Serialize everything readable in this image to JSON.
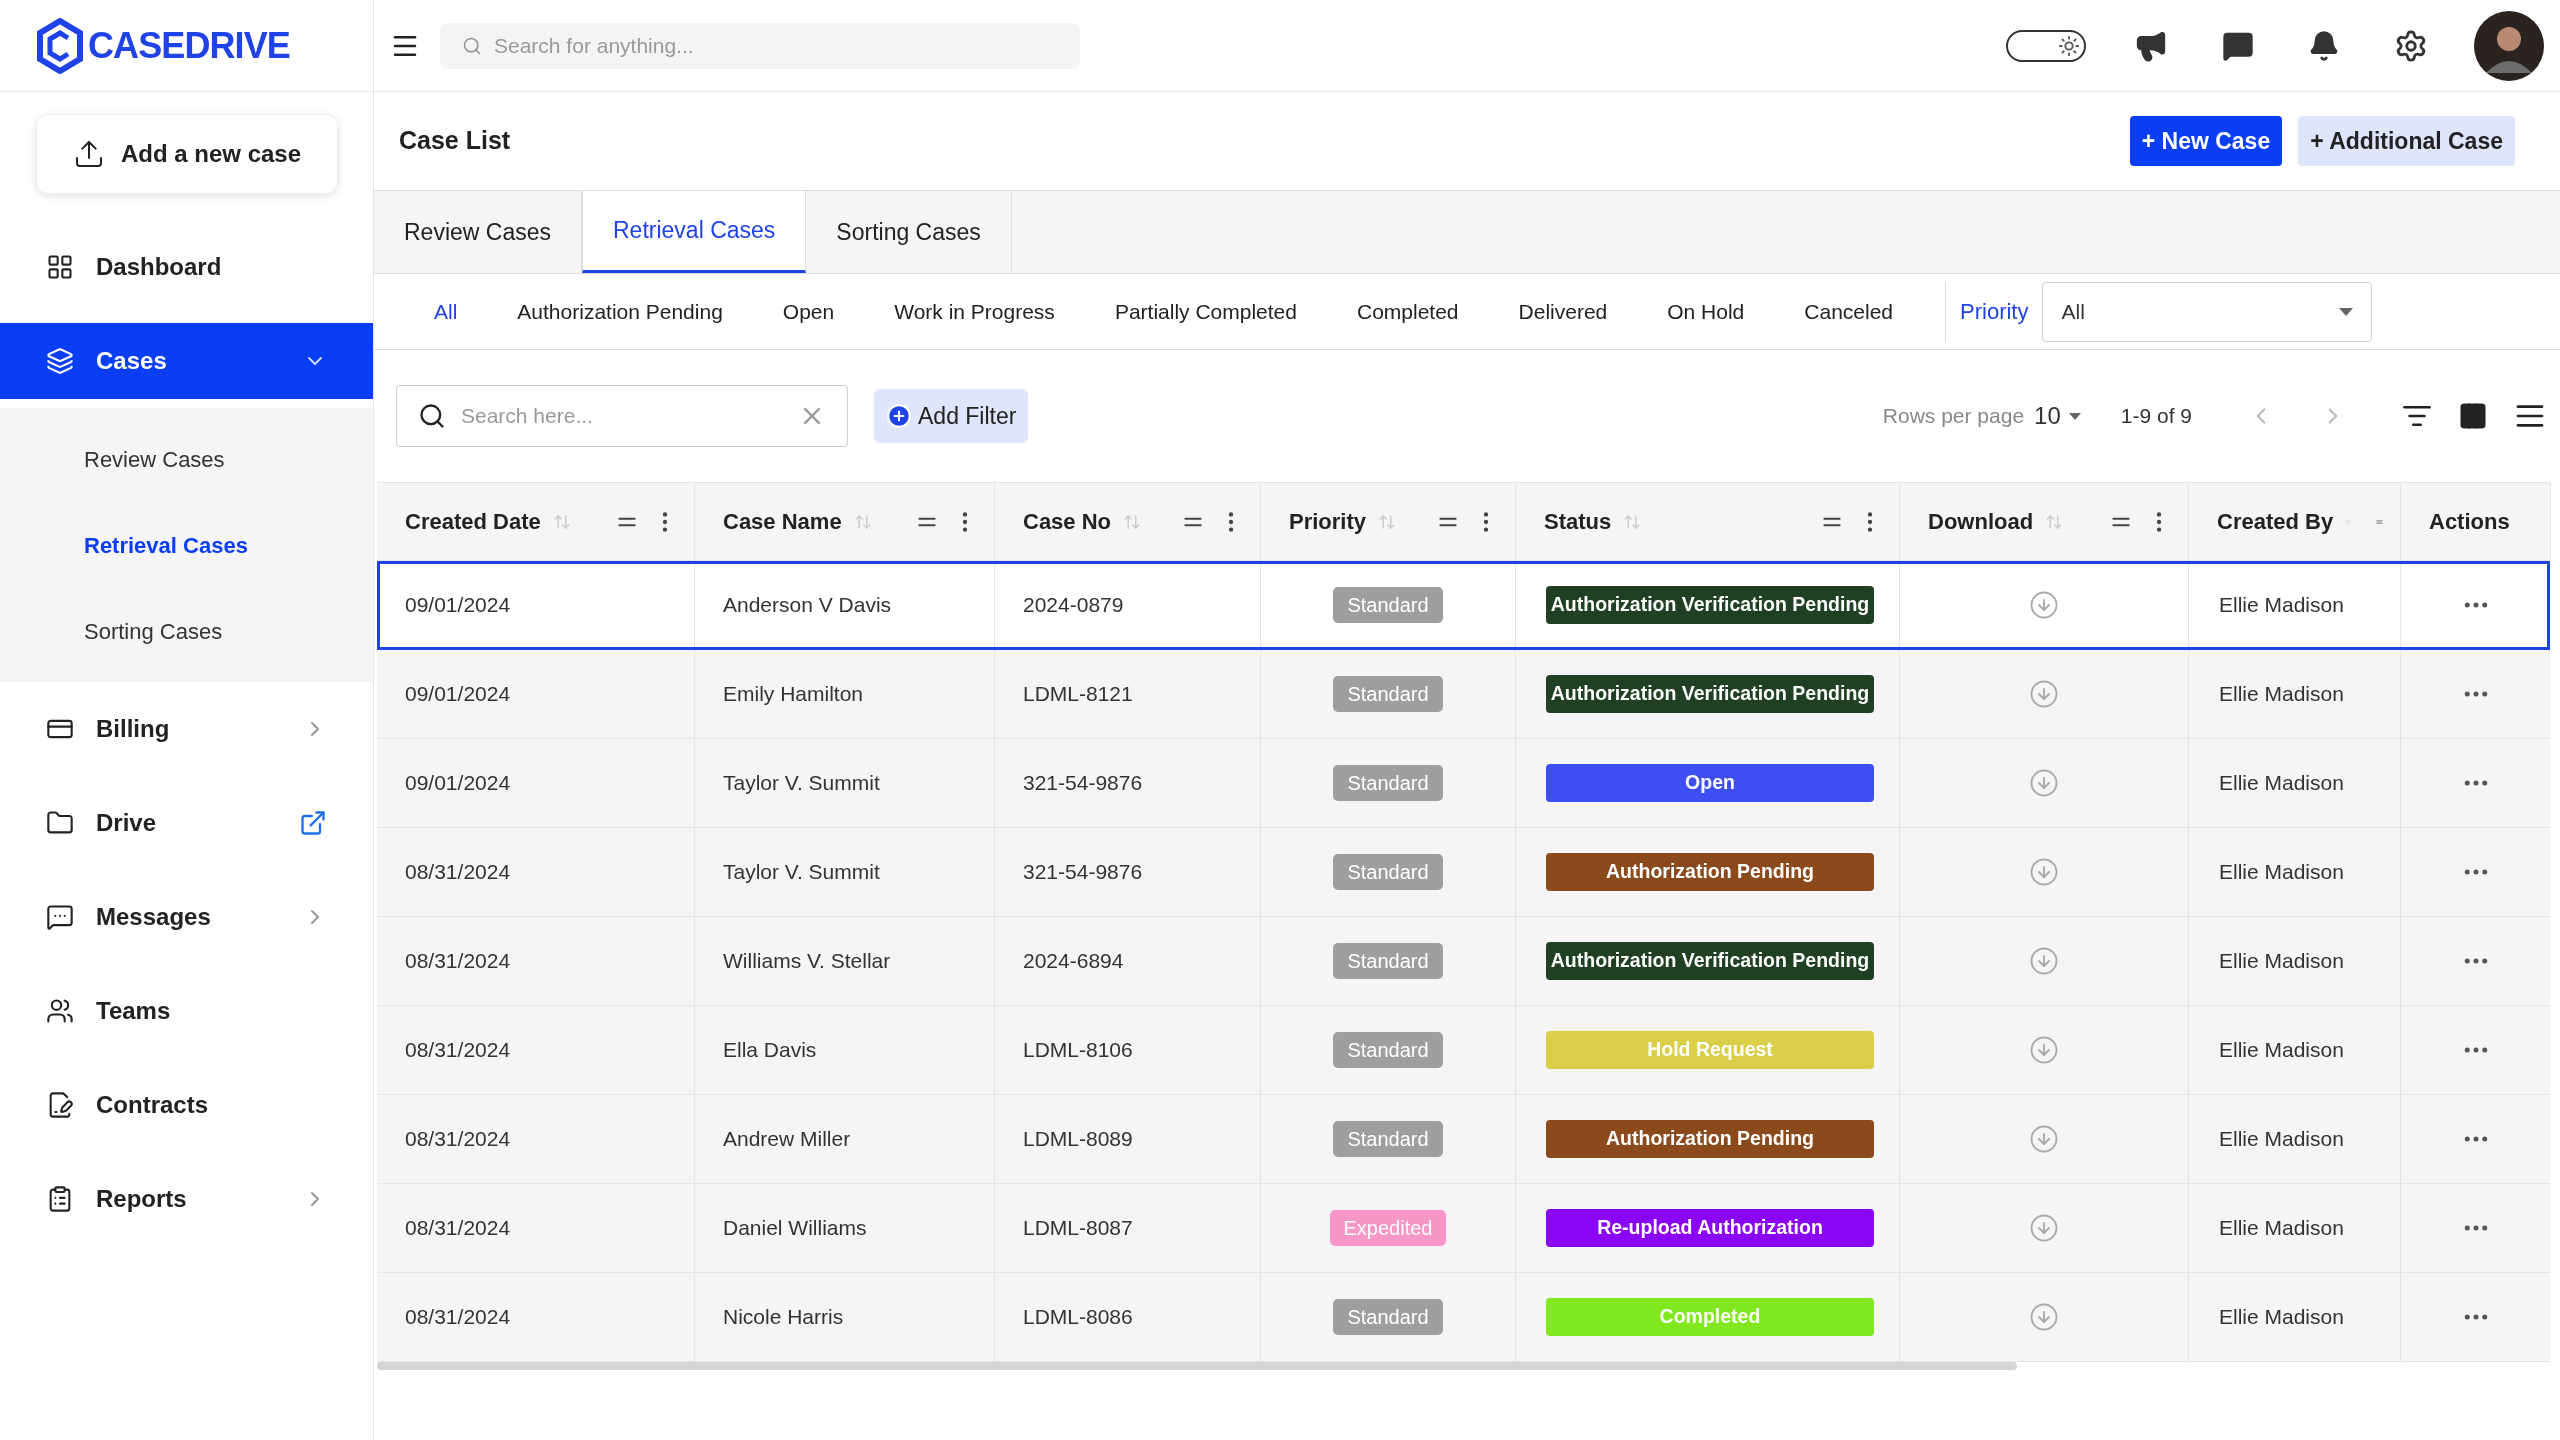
{
  "brand": {
    "name": "CASEDRIVE"
  },
  "topbar": {
    "search_placeholder": "Search for anything...",
    "dark_mode": false
  },
  "sidebar": {
    "add_button": "Add a new case",
    "items": [
      {
        "label": "Dashboard",
        "kind": "plain",
        "selected": false
      },
      {
        "label": "Cases",
        "kind": "group",
        "selected": true,
        "expanded": true,
        "children": [
          {
            "label": "Review Cases",
            "selected": false
          },
          {
            "label": "Retrieval Cases",
            "selected": true
          },
          {
            "label": "Sorting Cases",
            "selected": false
          }
        ]
      },
      {
        "label": "Billing",
        "kind": "group",
        "selected": false,
        "expanded": false
      },
      {
        "label": "Drive",
        "kind": "external",
        "selected": false
      },
      {
        "label": "Messages",
        "kind": "group",
        "selected": false,
        "expanded": false
      },
      {
        "label": "Teams",
        "kind": "plain",
        "selected": false
      },
      {
        "label": "Contracts",
        "kind": "plain",
        "selected": false
      },
      {
        "label": "Reports",
        "kind": "group",
        "selected": false,
        "expanded": false
      }
    ]
  },
  "page": {
    "title": "Case List",
    "buttons": [
      {
        "label": "+ New Case",
        "kind": "primary"
      },
      {
        "label": "+ Additional Case",
        "kind": "secondary"
      }
    ]
  },
  "tabs": [
    {
      "label": "Review Cases",
      "selected": false
    },
    {
      "label": "Retrieval Cases",
      "selected": true
    },
    {
      "label": "Sorting Cases",
      "selected": false
    }
  ],
  "status_filters": [
    {
      "label": "All",
      "selected": true
    },
    {
      "label": "Authorization Pending",
      "selected": false
    },
    {
      "label": "Open",
      "selected": false
    },
    {
      "label": "Work in Progress",
      "selected": false
    },
    {
      "label": "Partially Completed",
      "selected": false
    },
    {
      "label": "Completed",
      "selected": false
    },
    {
      "label": "Delivered",
      "selected": false
    },
    {
      "label": "On Hold",
      "selected": false
    },
    {
      "label": "Canceled",
      "selected": false
    }
  ],
  "priority_filter": {
    "label": "Priority",
    "value": "All"
  },
  "toolbar": {
    "search_placeholder": "Search here...",
    "add_filter": "Add Filter",
    "rows_per_page_label": "Rows per page",
    "rows_per_page": "10",
    "range": "1-9 of 9"
  },
  "table": {
    "columns": [
      {
        "label": "Created Date",
        "kind": "full"
      },
      {
        "label": "Case Name",
        "kind": "full"
      },
      {
        "label": "Case No",
        "kind": "full"
      },
      {
        "label": "Priority",
        "kind": "full"
      },
      {
        "label": "Status",
        "kind": "full"
      },
      {
        "label": "Download",
        "kind": "full"
      },
      {
        "label": "Created By",
        "kind": "narrow"
      },
      {
        "label": "Actions",
        "kind": "plain"
      }
    ],
    "rows": [
      {
        "selected": true,
        "date": "09/01/2024",
        "name": "Anderson V Davis",
        "case_no": "2024-0879",
        "priority": {
          "label": "Standard",
          "color": "#9e9e9e"
        },
        "status": {
          "label": "Authorization Verification Pending",
          "color": "#1f4023"
        },
        "created_by": "Ellie Madison"
      },
      {
        "selected": false,
        "date": "09/01/2024",
        "name": "Emily Hamilton",
        "case_no": "LDML-8121",
        "priority": {
          "label": "Standard",
          "color": "#9e9e9e"
        },
        "status": {
          "label": "Authorization Verification Pending",
          "color": "#1f4023"
        },
        "created_by": "Ellie Madison"
      },
      {
        "selected": false,
        "date": "09/01/2024",
        "name": "Taylor V. Summit",
        "case_no": "321-54-9876",
        "priority": {
          "label": "Standard",
          "color": "#9e9e9e"
        },
        "status": {
          "label": "Open",
          "color": "#3d4ff2"
        },
        "created_by": "Ellie Madison"
      },
      {
        "selected": false,
        "date": "08/31/2024",
        "name": "Taylor V. Summit",
        "case_no": "321-54-9876",
        "priority": {
          "label": "Standard",
          "color": "#9e9e9e"
        },
        "status": {
          "label": "Authorization Pending",
          "color": "#8b4a1c"
        },
        "created_by": "Ellie Madison"
      },
      {
        "selected": false,
        "date": "08/31/2024",
        "name": "Williams V. Stellar",
        "case_no": "2024-6894",
        "priority": {
          "label": "Standard",
          "color": "#9e9e9e"
        },
        "status": {
          "label": "Authorization Verification Pending",
          "color": "#1f4023"
        },
        "created_by": "Ellie Madison"
      },
      {
        "selected": false,
        "date": "08/31/2024",
        "name": "Ella Davis",
        "case_no": "LDML-8106",
        "priority": {
          "label": "Standard",
          "color": "#9e9e9e"
        },
        "status": {
          "label": "Hold Request",
          "color": "#d9cf48"
        },
        "created_by": "Ellie Madison"
      },
      {
        "selected": false,
        "date": "08/31/2024",
        "name": "Andrew Miller",
        "case_no": "LDML-8089",
        "priority": {
          "label": "Standard",
          "color": "#9e9e9e"
        },
        "status": {
          "label": "Authorization Pending",
          "color": "#8b4a1c"
        },
        "created_by": "Ellie Madison"
      },
      {
        "selected": false,
        "date": "08/31/2024",
        "name": "Daniel Williams",
        "case_no": "LDML-8087",
        "priority": {
          "label": "Expedited",
          "color": "#f598c8"
        },
        "status": {
          "label": "Re-upload Authorization",
          "color": "#8a05f5"
        },
        "created_by": "Ellie Madison"
      },
      {
        "selected": false,
        "date": "08/31/2024",
        "name": "Nicole Harris",
        "case_no": "LDML-8086",
        "priority": {
          "label": "Standard",
          "color": "#9e9e9e"
        },
        "status": {
          "label": "Completed",
          "color": "#80e81c"
        },
        "created_by": "Ellie Madison"
      }
    ]
  }
}
